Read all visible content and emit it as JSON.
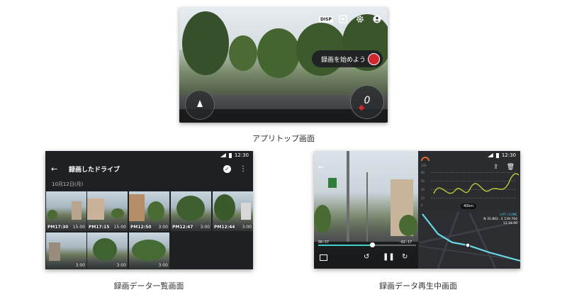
{
  "captions": {
    "top": "アプリトップ画面",
    "list": "録画データ一覧画面",
    "playback": "録画データ再生中画面"
  },
  "top_screen": {
    "disp_label": "DISP",
    "record_prompt": "録画を始めよう",
    "speed": "0",
    "icons": [
      "disp-icon",
      "gallery-icon",
      "settings-gear-icon",
      "account-icon"
    ],
    "record_color": "#d0282e"
  },
  "list_screen": {
    "status_time": "12:30",
    "title": "録画したドライブ",
    "date": "10月12日(月)",
    "thumbs": [
      {
        "time": "PM17:30",
        "duration": "15:00"
      },
      {
        "time": "PM17:15",
        "duration": "15:00"
      },
      {
        "time": "PM12:50",
        "duration": "3:00"
      },
      {
        "time": "PM12:47",
        "duration": "3:00"
      },
      {
        "time": "PM12:44",
        "duration": "3:00"
      },
      {
        "time": "",
        "duration": "3:00"
      },
      {
        "time": "",
        "duration": "3:00"
      },
      {
        "time": "",
        "duration": "3:00"
      }
    ]
  },
  "play_screen": {
    "status_time": "12:30",
    "time_elapsed": "00:57",
    "time_remaining": "-02:17",
    "progress": 0.55,
    "distance_chip": "40km",
    "map_info_title": "LAT / LONE",
    "map_info_line1": "N 35.862 , E 139.764",
    "map_info_line2": "12:34:56",
    "graph_y_labels": [
      "100",
      "80",
      "60",
      "40",
      "20",
      "0"
    ],
    "accent_color": "#3fd0c9",
    "curve_color": "#c8d43a"
  }
}
